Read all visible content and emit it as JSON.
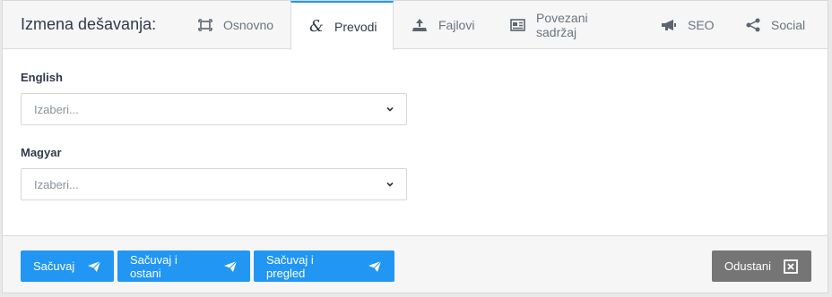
{
  "header": {
    "title": "Izmena dešavanja:",
    "tabs": [
      {
        "label": "Osnovno",
        "icon": "frame-icon",
        "active": false
      },
      {
        "label": "Prevodi",
        "icon": "ampersand-icon",
        "active": true
      },
      {
        "label": "Fajlovi",
        "icon": "upload-icon",
        "active": false
      },
      {
        "label": "Povezani sadržaj",
        "icon": "newspaper-icon",
        "active": false
      },
      {
        "label": "SEO",
        "icon": "megaphone-icon",
        "active": false
      },
      {
        "label": "Social",
        "icon": "share-icon",
        "active": false
      }
    ]
  },
  "fields": [
    {
      "label": "English",
      "placeholder": "Izaberi..."
    },
    {
      "label": "Magyar",
      "placeholder": "Izaberi..."
    }
  ],
  "footer": {
    "save": "Sačuvaj",
    "save_stay": "Sačuvaj i ostani",
    "save_view": "Sačuvaj i pregled",
    "cancel": "Odustani"
  },
  "colors": {
    "accent": "#2196f3",
    "cancel": "#757575"
  }
}
